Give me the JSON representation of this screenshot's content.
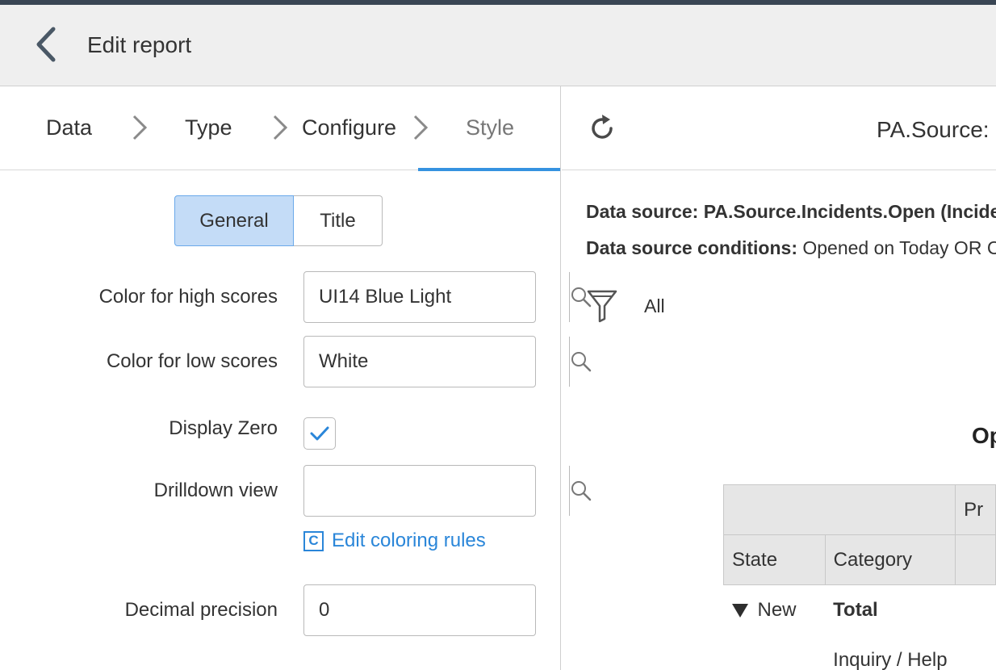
{
  "header": {
    "title": "Edit report"
  },
  "breadcrumbs": [
    {
      "label": "Data"
    },
    {
      "label": "Type"
    },
    {
      "label": "Configure"
    },
    {
      "label": "Style"
    }
  ],
  "tabs": {
    "general": "General",
    "title": "Title"
  },
  "form": {
    "high_scores": {
      "label": "Color for high scores",
      "value": "UI14 Blue Light"
    },
    "low_scores": {
      "label": "Color for low scores",
      "value": "White"
    },
    "display_zero": {
      "label": "Display Zero",
      "checked": true
    },
    "drilldown": {
      "label": "Drilldown view",
      "value": ""
    },
    "edit_coloring": {
      "icon_letter": "C",
      "label": "Edit coloring rules"
    },
    "decimal": {
      "label": "Decimal precision",
      "value": "0"
    }
  },
  "preview": {
    "title": "PA.Source:",
    "data_source_label": "Data source:",
    "data_source_value": "PA.Source.Incidents.Open (Incider",
    "conditions_label": "Data source conditions:",
    "conditions_value": "Opened on Today OR C",
    "filter_text": "All",
    "chart_heading": "Op",
    "table": {
      "top_header_right": "Pr",
      "col_state": "State",
      "col_category": "Category",
      "row1_state": "New",
      "row1_category": "Total",
      "row2_category": "Inquiry / Help"
    }
  },
  "colors": {
    "accent": "#3592e0",
    "link": "#2a86d9",
    "selected_tab": "#c4dcf7"
  }
}
